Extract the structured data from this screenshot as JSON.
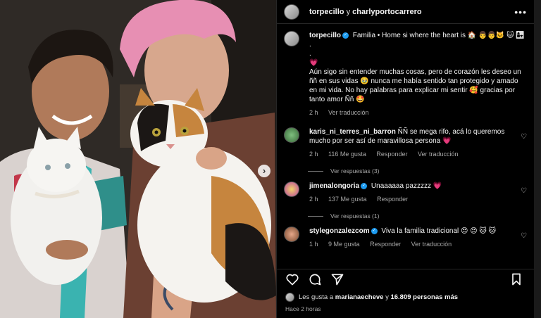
{
  "header": {
    "author1": "torpecillo",
    "joiner": "y",
    "author2": "charlyportocarrero",
    "more_label": "•••"
  },
  "caption": {
    "username": "torpecillo",
    "text_line1": "Familia • Home si where the heart is 🏠 👨‍👨‍🐱 🐱 👩‍👧",
    "dots": ".",
    "heart": "💗",
    "text_body": "Aún sigo sin entender muchas cosas, pero de corazón les deseo un ññ en sus vidas 🥹 nunca me había sentido tan protegido y amado en mi vida. No hay palabras para explicar mi sentir 🥰 gracias por tanto amor Ññ 🤩",
    "time": "2 h",
    "translate": "Ver traducción"
  },
  "comments": [
    {
      "username": "karis_ni_terres_ni_barron",
      "text": "ÑÑ se mega rifo, acá lo queremos mucho por ser así de maravillosa persona 💗",
      "time": "2 h",
      "likes": "116 Me gusta",
      "reply": "Responder",
      "translate": "Ver traducción",
      "view_replies": "Ver respuestas (3)"
    },
    {
      "username": "jimenalongoria",
      "text": "Unaaaaaa pazzzzz 💗",
      "time": "2 h",
      "likes": "137 Me gusta",
      "reply": "Responder",
      "view_replies": "Ver respuestas (1)"
    },
    {
      "username": "stylegonzalezcom",
      "text": "Viva la familia tradicional 😍 😍 🐱 🐱",
      "time": "1 h",
      "likes": "9 Me gusta",
      "reply": "Responder",
      "translate": "Ver traducción"
    }
  ],
  "likes_bar": {
    "prefix": "Les gusta a",
    "user": "marianaecheve",
    "middle": "y",
    "count": "16.809 personas más"
  },
  "posted": "Hace 2 horas",
  "icons": [
    "heart-icon",
    "comment-icon",
    "share-icon",
    "bookmark-icon",
    "verified-icon",
    "more-icon",
    "carousel-next-icon"
  ],
  "colors": {
    "verified": "#1d9bf0",
    "hair": "#e78fb3",
    "background": "#000000"
  }
}
